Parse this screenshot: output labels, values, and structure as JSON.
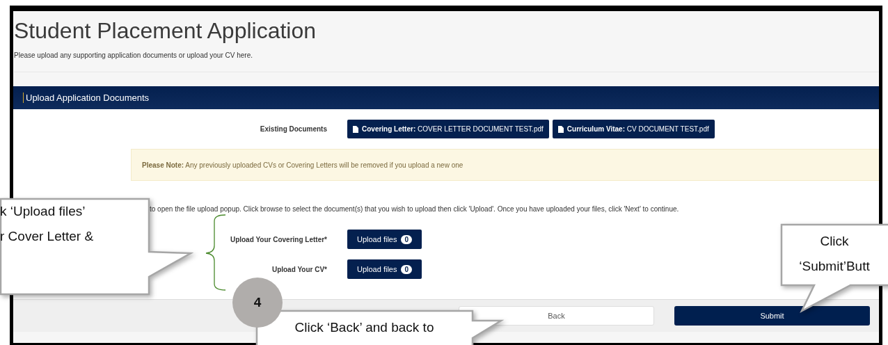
{
  "page": {
    "title": "Student Placement Application",
    "subtitle": "Please upload any supporting application documents or upload your CV here."
  },
  "panel": {
    "title": "Upload Application Documents",
    "existing_documents": {
      "label": "Existing Documents",
      "files": [
        "**Covering Letter:** COVER LETTER DOCUMENT TEST.pdf",
        "**Curriculum Vitae:** CV DOCUMENT TEST.pdf"
      ]
    },
    "note": "**Please Note:** Any previously uploaded CVs or Covering Letters will be removed if you upload a new one",
    "instructions": "to open the file upload popup. Click browse to select the document(s) that you wish to upload then click 'Upload'. Once you have uploaded your files, click 'Next' to continue.",
    "uploads": [
      {
        "label": "Upload Your Covering Letter*",
        "button": "Upload files",
        "count": "0"
      },
      {
        "label": "Upload Your CV*",
        "button": "Upload files",
        "count": "0"
      }
    ],
    "buttons": [
      {
        "label": "Back",
        "kind": "secondary"
      },
      {
        "label": "Submit",
        "kind": "primary"
      }
    ]
  },
  "annotations": {
    "step_number": "4",
    "callouts": [
      {
        "lines": [
          "k ‘Upload files’",
          "r Cover Letter &"
        ]
      },
      {
        "lines": [
          "Click ‘Back’ and back to"
        ]
      },
      {
        "lines": [
          "Click",
          "‘Submit’Butt"
        ]
      }
    ]
  }
}
